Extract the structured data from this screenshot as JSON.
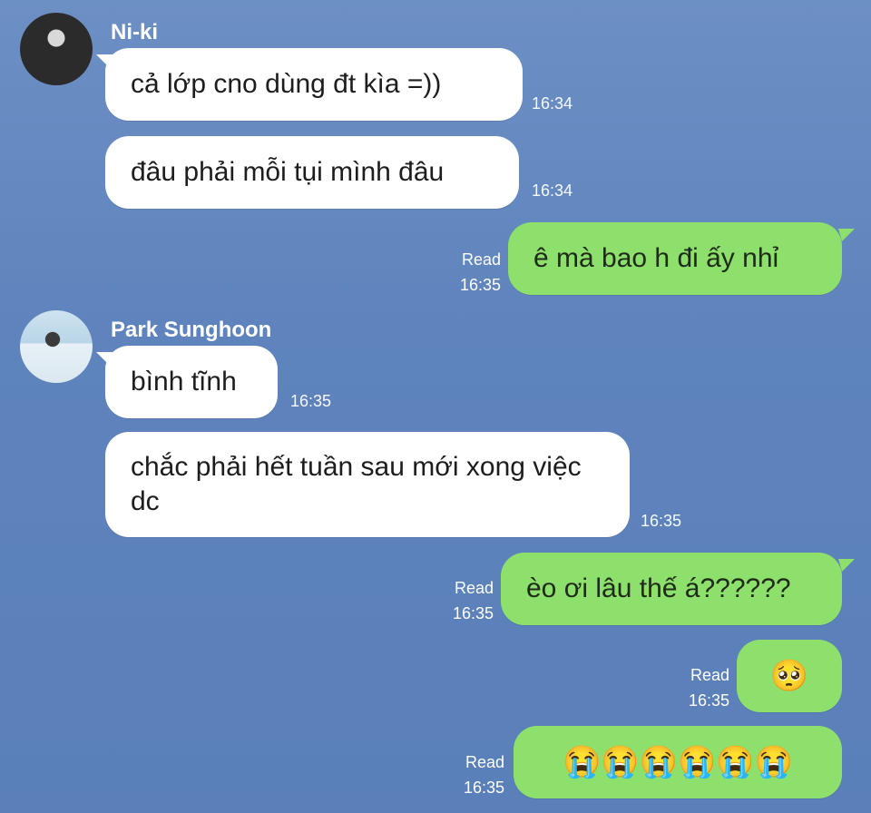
{
  "messages": [
    {
      "sender": "Ni-ki",
      "text": "cả lớp cno dùng đt kìa =))",
      "time": "16:34"
    },
    {
      "sender": "Ni-ki",
      "text": "đâu phải mỗi tụi mình đâu",
      "time": "16:34"
    },
    {
      "sender": "me",
      "text": "ê mà bao h đi ấy nhỉ",
      "status": "Read",
      "time": "16:35"
    },
    {
      "sender": "Park Sunghoon",
      "text": "bình tĩnh",
      "time": "16:35"
    },
    {
      "sender": "Park Sunghoon",
      "text": "chắc phải hết tuần sau mới xong việc dc",
      "time": "16:35"
    },
    {
      "sender": "me",
      "text": "èo ơi lâu thế á??????",
      "status": "Read",
      "time": "16:35"
    },
    {
      "sender": "me",
      "text": "🥺",
      "status": "Read",
      "time": "16:35"
    },
    {
      "sender": "me",
      "text": "😭😭😭😭😭😭",
      "status": "Read",
      "time": "16:35"
    }
  ],
  "senders": {
    "niki": "Ni-ki",
    "park": "Park Sunghoon"
  },
  "colors": {
    "background": "#5f84bd",
    "incoming_bubble": "#ffffff",
    "outgoing_bubble": "#8ee06c"
  }
}
